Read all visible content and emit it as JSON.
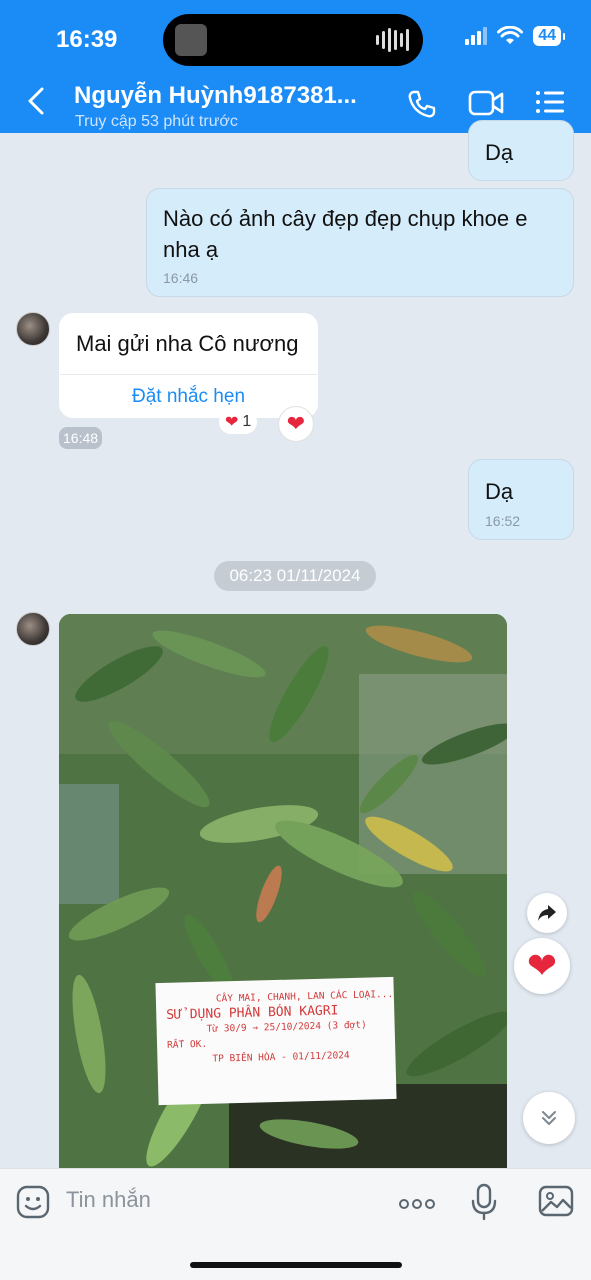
{
  "status_bar": {
    "time": "16:39",
    "battery": "44"
  },
  "header": {
    "contact_name": "Nguyễn Huỳnh9187381...",
    "last_seen": "Truy cập 53 phút trước"
  },
  "messages": [
    {
      "direction": "out",
      "text": "Dạ"
    },
    {
      "direction": "out",
      "text": "Nào có ảnh cây đẹp đẹp chụp khoe e nha ạ",
      "time": "16:46"
    },
    {
      "direction": "in",
      "text": "Mai gửi nha Cô nương",
      "action": "Đặt nhắc hẹn",
      "time": "16:48",
      "reaction_count": "1"
    },
    {
      "direction": "out",
      "text": "Dạ",
      "time": "16:52"
    }
  ],
  "date_separator": "06:23 01/11/2024",
  "photo": {
    "sign_lines": [
      "CÂY MAI, CHANH, LAN CÁC LOẠI...",
      "SỬ DỤNG PHÂN BÓN KAGRI",
      "Từ 30/9 → 25/10/2024 (3 đợt)",
      "RẤT OK.",
      "TP BIÊN HÒA - 01/11/2024"
    ]
  },
  "input": {
    "placeholder": "Tin nhắn"
  },
  "colors": {
    "accent": "#1b8bf5",
    "heart": "#e6263d",
    "outgoing_bubble": "#d5ecfb",
    "background": "#e2e9f1"
  }
}
